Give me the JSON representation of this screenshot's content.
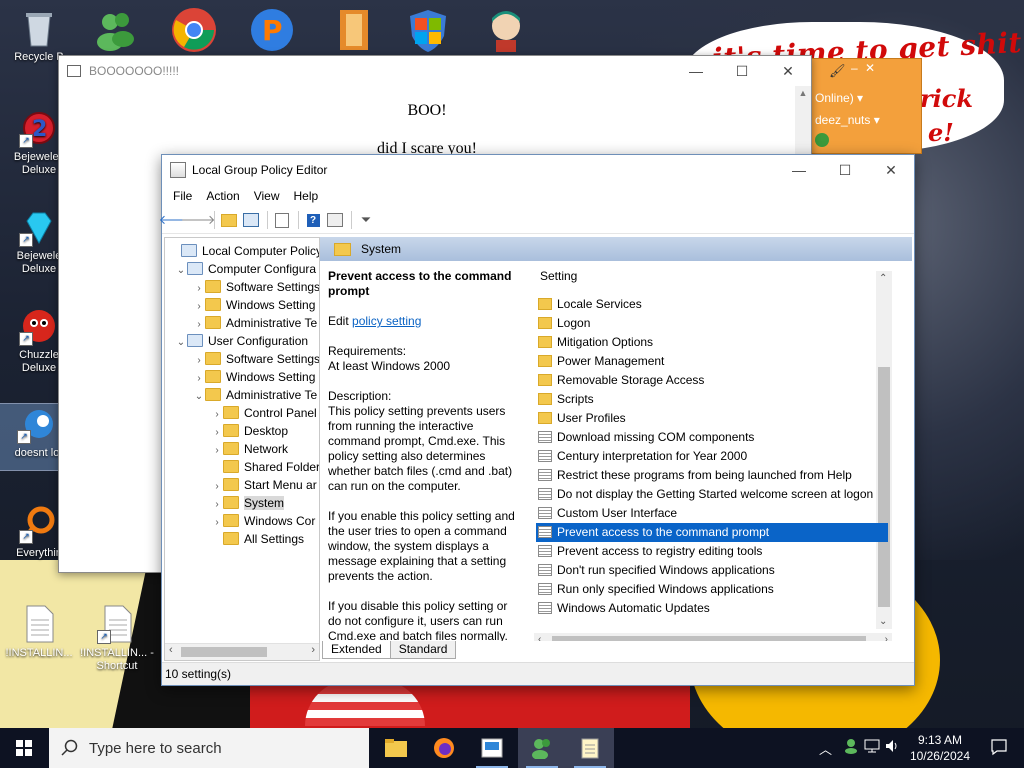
{
  "desktop": {
    "icons": [
      {
        "label": "Recycle Bin",
        "display": "Recycle B"
      },
      {
        "label": "Bejeweled Deluxe",
        "display": "Bejewelec Deluxe"
      },
      {
        "label": "Bejeweled Deluxe",
        "display": "Bejewele Deluxe"
      },
      {
        "label": "Chuzzle Deluxe",
        "display": "Chuzzle Deluxe"
      },
      {
        "label": "doesnt lo",
        "display": "doesnt lo"
      },
      {
        "label": "Everything",
        "display": "Everythin"
      },
      {
        "label": "!INSTALLIN...",
        "display": "!INSTALLIN..."
      },
      {
        "label": "!INSTALLIN... - Shortcut",
        "display": "!INSTALLIN... - Shortcut"
      }
    ],
    "speech_bubble": {
      "line1": "it's time to get shit",
      "line2": "rick",
      "line3": "e!"
    },
    "messenger": {
      "status": "Online)",
      "status_suffix": "▾",
      "name": "deez_nuts",
      "name_suffix": "▾"
    }
  },
  "boo_window": {
    "title": "BOOOOOOO!!!!!",
    "heading": "BOO!",
    "line2": "did I scare you!"
  },
  "gpedit": {
    "title": "Local Group Policy Editor",
    "menu": [
      "File",
      "Action",
      "View",
      "Help"
    ],
    "tree": [
      {
        "label": "Local Computer Policy",
        "level": 0,
        "twisty": ""
      },
      {
        "label": "Computer Configura",
        "level": 1,
        "twisty": "⌄"
      },
      {
        "label": "Software Settings",
        "level": 2,
        "twisty": "›"
      },
      {
        "label": "Windows Setting",
        "level": 2,
        "twisty": "›"
      },
      {
        "label": "Administrative Te",
        "level": 2,
        "twisty": "›"
      },
      {
        "label": "User Configuration",
        "level": 1,
        "twisty": "⌄"
      },
      {
        "label": "Software Settings",
        "level": 2,
        "twisty": "›"
      },
      {
        "label": "Windows Setting",
        "level": 2,
        "twisty": "›"
      },
      {
        "label": "Administrative Te",
        "level": 2,
        "twisty": "⌄"
      },
      {
        "label": "Control Panel",
        "level": 3,
        "twisty": "›"
      },
      {
        "label": "Desktop",
        "level": 3,
        "twisty": "›"
      },
      {
        "label": "Network",
        "level": 3,
        "twisty": "›"
      },
      {
        "label": "Shared Folder",
        "level": 3,
        "twisty": ""
      },
      {
        "label": "Start Menu ar",
        "level": 3,
        "twisty": "›"
      },
      {
        "label": "System",
        "level": 3,
        "twisty": "›",
        "selected": true
      },
      {
        "label": "Windows Cor",
        "level": 3,
        "twisty": "›"
      },
      {
        "label": "All Settings",
        "level": 3,
        "twisty": ""
      }
    ],
    "header": "System",
    "description": {
      "title": "Prevent access to the command prompt",
      "edit_prefix": "Edit",
      "edit_link": "policy setting",
      "requirements_label": "Requirements:",
      "requirements": "At least Windows 2000",
      "description_label": "Description:",
      "p1": "This policy setting prevents users from running the interactive command prompt, Cmd.exe.  This policy setting also determines whether batch files (.cmd and .bat) can run on the computer.",
      "p2": "If you enable this policy setting and the user tries to open a command window, the system displays a message explaining that a setting prevents the action.",
      "p3": "If you disable this policy setting or do not configure it, users can run Cmd.exe and batch files normally."
    },
    "list_header": "Setting",
    "settings": [
      {
        "label": "Locale Services",
        "type": "folder"
      },
      {
        "label": "Logon",
        "type": "folder"
      },
      {
        "label": "Mitigation Options",
        "type": "folder"
      },
      {
        "label": "Power Management",
        "type": "folder"
      },
      {
        "label": "Removable Storage Access",
        "type": "folder"
      },
      {
        "label": "Scripts",
        "type": "folder"
      },
      {
        "label": "User Profiles",
        "type": "folder"
      },
      {
        "label": "Download missing COM components",
        "type": "setting"
      },
      {
        "label": "Century interpretation for Year 2000",
        "type": "setting"
      },
      {
        "label": "Restrict these programs from being launched from Help",
        "type": "setting"
      },
      {
        "label": "Do not display the Getting Started welcome screen at logon",
        "type": "setting"
      },
      {
        "label": "Custom User Interface",
        "type": "setting"
      },
      {
        "label": "Prevent access to the command prompt",
        "type": "setting",
        "selected": true
      },
      {
        "label": "Prevent access to registry editing tools",
        "type": "setting"
      },
      {
        "label": "Don't run specified Windows applications",
        "type": "setting"
      },
      {
        "label": "Run only specified Windows applications",
        "type": "setting"
      },
      {
        "label": "Windows Automatic Updates",
        "type": "setting"
      }
    ],
    "tabs": [
      "Extended",
      "Standard"
    ],
    "status": "10 setting(s)"
  },
  "taskbar": {
    "search_placeholder": "Type here to search",
    "time": "9:13 AM",
    "date": "10/26/2024"
  },
  "colors": {
    "accent": "#0a64c8",
    "taskbar": "#0d1222",
    "messenger": "#f3a03c"
  }
}
